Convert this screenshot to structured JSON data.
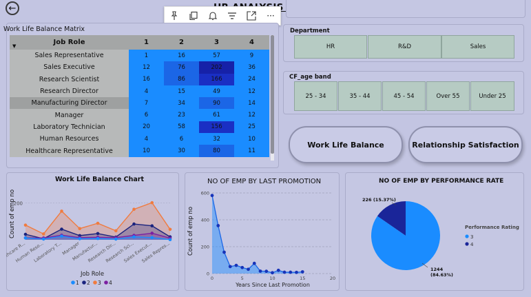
{
  "header": {
    "title": "HR ANALYSIS DASHBOARD",
    "back_icon": "back-arrow-icon"
  },
  "toolbar": {
    "icons": [
      "pin-icon",
      "copy-icon",
      "bell-icon",
      "filter-icon",
      "expand-icon",
      "more-icon"
    ],
    "more_label": "···"
  },
  "matrix": {
    "title": "Work Life Balance Matrix",
    "header": [
      "Job Role",
      "1",
      "2",
      "3",
      "4"
    ],
    "rows": [
      {
        "role": "Sales Representative",
        "values": [
          "1",
          "16",
          "57",
          "9"
        ]
      },
      {
        "role": "Sales Executive",
        "values": [
          "12",
          "76",
          "202",
          "36"
        ]
      },
      {
        "role": "Research Scientist",
        "values": [
          "16",
          "86",
          "166",
          "24"
        ]
      },
      {
        "role": "Research Director",
        "values": [
          "4",
          "15",
          "49",
          "12"
        ]
      },
      {
        "role": "Manufacturing Director",
        "values": [
          "7",
          "34",
          "90",
          "14"
        ]
      },
      {
        "role": "Manager",
        "values": [
          "6",
          "23",
          "61",
          "12"
        ]
      },
      {
        "role": "Laboratory Technician",
        "values": [
          "20",
          "58",
          "156",
          "25"
        ]
      },
      {
        "role": "Human Resources",
        "values": [
          "4",
          "6",
          "32",
          "10"
        ]
      },
      {
        "role": "Healthcare Representative",
        "values": [
          "10",
          "30",
          "80",
          "11"
        ]
      }
    ],
    "highlight_row": 4,
    "colors": {
      "low": "#1a8cff",
      "mid": "#1b66e6",
      "high": "#1a2fc4",
      "max": "#1621a8"
    }
  },
  "department": {
    "label": "Department",
    "options": [
      "HR",
      "R&D",
      "Sales"
    ]
  },
  "age_band": {
    "label": "CF_age band",
    "options": [
      "25 - 34",
      "35 - 44",
      "45 - 54",
      "Over 55",
      "Under 25"
    ]
  },
  "buttons": {
    "wlb": "Work Life Balance",
    "rel": "Relationship Satisfaction"
  },
  "chart_data": [
    {
      "type": "area",
      "title": "Work Life Balance Chart",
      "xlabel": "Job Role",
      "ylabel": "Count of emp no",
      "yticks": [
        "200"
      ],
      "ylim": [
        0,
        300
      ],
      "categories": [
        "Healthcare R...",
        "Human Reso...",
        "Laboratory T...",
        "Manager",
        "Manufactur...",
        "Research Dir...",
        "Research Sci...",
        "Sales Execut...",
        "Sales Repres..."
      ],
      "series": [
        {
          "name": "1",
          "color": "#1a8cff",
          "values": [
            10,
            4,
            20,
            6,
            7,
            4,
            16,
            12,
            1
          ]
        },
        {
          "name": "2",
          "color": "#1a237e",
          "values": [
            30,
            6,
            58,
            23,
            34,
            15,
            86,
            76,
            16
          ]
        },
        {
          "name": "3",
          "color": "#f07b3f",
          "values": [
            80,
            32,
            156,
            61,
            90,
            49,
            166,
            202,
            57
          ]
        },
        {
          "name": "4",
          "color": "#7b1fa2",
          "values": [
            11,
            10,
            25,
            12,
            14,
            12,
            24,
            36,
            9
          ]
        }
      ],
      "legend": [
        "1",
        "2",
        "3",
        "4"
      ]
    },
    {
      "type": "line",
      "title": "NO OF EMP BY LAST PROMOTION",
      "xlabel": "Years Since Last Promotion",
      "ylabel": "Count of emp no",
      "yticks": [
        "0",
        "200",
        "400",
        "600"
      ],
      "xticks": [
        "0",
        "5",
        "10",
        "15",
        "20"
      ],
      "xlim": [
        0,
        20
      ],
      "ylim": [
        0,
        600
      ],
      "x": [
        0,
        1,
        2,
        3,
        4,
        5,
        6,
        7,
        8,
        9,
        10,
        11,
        12,
        13,
        14,
        15
      ],
      "y": [
        581,
        357,
        159,
        52,
        61,
        45,
        32,
        76,
        18,
        17,
        6,
        24,
        10,
        10,
        9,
        13
      ],
      "color": "#1a66e6"
    },
    {
      "type": "pie",
      "title": "NO OF EMP BY PERFORMANCE RATE",
      "legend_title": "Performance Rating",
      "slices": [
        {
          "label": "3",
          "value": 1244,
          "data_label": "1244\n(84.63%)",
          "color": "#1a8cff"
        },
        {
          "label": "4",
          "value": 226,
          "data_label": "226 (15.37%)",
          "color": "#1a2599"
        }
      ]
    }
  ]
}
